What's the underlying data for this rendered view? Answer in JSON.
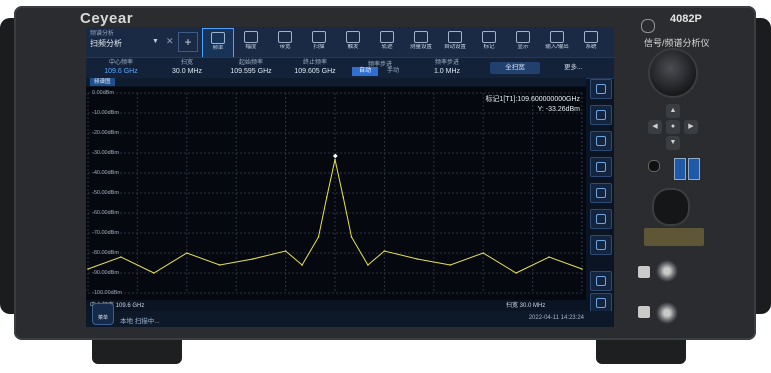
{
  "device": {
    "brand": "Ceyear",
    "model": "4082P",
    "subtitle": "信号/频谱分析仪"
  },
  "mode": {
    "label": "频谱分析",
    "name": "扫频分析"
  },
  "toolbar": [
    {
      "label": "频率",
      "active": true
    },
    {
      "label": "幅度",
      "active": false
    },
    {
      "label": "带宽",
      "active": false
    },
    {
      "label": "扫描",
      "active": false
    },
    {
      "label": "触发",
      "active": false
    },
    {
      "label": "轨迹",
      "active": false
    },
    {
      "label": "测量设置",
      "active": false
    },
    {
      "label": "自动设置",
      "active": false
    },
    {
      "label": "标记",
      "active": false
    },
    {
      "label": "显示",
      "active": false
    },
    {
      "label": "输入/输出",
      "active": false
    },
    {
      "label": "系统",
      "active": false
    }
  ],
  "params": {
    "center_freq": {
      "label": "中心频率",
      "value": "109.6 GHz"
    },
    "span": {
      "label": "扫宽",
      "value": "30.0 MHz"
    },
    "start_freq": {
      "label": "起始频率",
      "value": "109.595 GHz"
    },
    "stop_freq": {
      "label": "终止频率",
      "value": "109.605 GHz"
    },
    "step_mode": {
      "label": "频率步进",
      "auto": "自动",
      "manual": "手动"
    },
    "step": {
      "label": "频率步进",
      "value": "1.0 MHz"
    },
    "full_span": "全扫宽",
    "more": "更多..."
  },
  "trace_tab": "频谱图",
  "marker": {
    "line1": "标记1[T1]:109.600000000GHz",
    "line2": "Y: -33.26dBm"
  },
  "y_ticks": [
    "0.00dBm",
    "-10.00dBm",
    "-20.00dBm",
    "-30.00dBm",
    "-40.00dBm",
    "-50.00dBm",
    "-60.00dBm",
    "-70.00dBm",
    "-80.00dBm",
    "-90.00dBm",
    "-100.00dBm"
  ],
  "axis": {
    "center": "中心频率 109.6 GHz",
    "span": "扫宽 30.0 MHz"
  },
  "status": {
    "home": "菜单",
    "text": "本地 扫描中...",
    "clock": "2022-04-11 14:23:24"
  },
  "chart_data": {
    "type": "line",
    "ylim": [
      -100,
      0
    ],
    "x": [
      109.585,
      109.587,
      109.589,
      109.591,
      109.593,
      109.595,
      109.597,
      109.598,
      109.599,
      109.5995,
      109.6,
      109.6005,
      109.601,
      109.602,
      109.603,
      109.605,
      109.607,
      109.609,
      109.611,
      109.613,
      109.615
    ],
    "series": [
      {
        "values": [
          -88,
          -82,
          -90,
          -80,
          -86,
          -83,
          -79,
          -86,
          -72,
          -52,
          -33.26,
          -52,
          -72,
          -86,
          -79,
          -83,
          -86,
          -80,
          -90,
          -82,
          -88
        ]
      }
    ]
  }
}
